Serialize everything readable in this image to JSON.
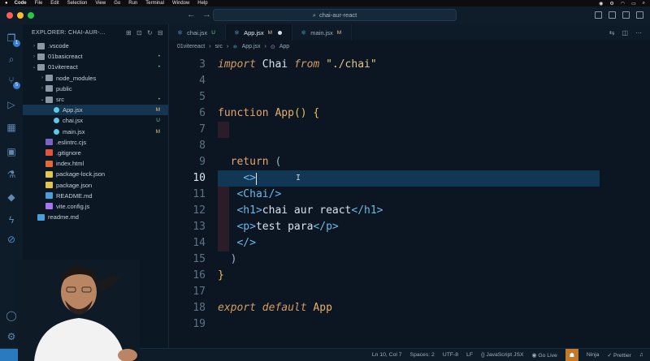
{
  "menubar": {
    "items": [
      "Code",
      "File",
      "Edit",
      "Selection",
      "View",
      "Go",
      "Run",
      "Terminal",
      "Window",
      "Help"
    ]
  },
  "titlebar": {
    "search": "chai-aur-react"
  },
  "activity": {
    "explorer_badge": "1",
    "scm_badge": "5"
  },
  "sidebar": {
    "title": "EXPLORER: CHAI-AUR-...",
    "tree": [
      {
        "name": ".vscode",
        "type": "folder",
        "depth": 0,
        "open": false,
        "status": ""
      },
      {
        "name": "01basicreact",
        "type": "folder",
        "depth": 0,
        "open": false,
        "status": "•"
      },
      {
        "name": "01vitereact",
        "type": "folder",
        "depth": 0,
        "open": true,
        "status": "•"
      },
      {
        "name": "node_modules",
        "type": "folder",
        "depth": 1,
        "open": false,
        "status": ""
      },
      {
        "name": "public",
        "type": "folder",
        "depth": 1,
        "open": false,
        "status": ""
      },
      {
        "name": "src",
        "type": "folder",
        "depth": 1,
        "open": true,
        "status": "•"
      },
      {
        "name": "App.jsx",
        "type": "react",
        "depth": 2,
        "status": "M",
        "selected": true
      },
      {
        "name": "chai.jsx",
        "type": "react",
        "depth": 2,
        "status": "U"
      },
      {
        "name": "main.jsx",
        "type": "react",
        "depth": 2,
        "status": "M"
      },
      {
        "name": ".eslintrc.cjs",
        "type": "eslint",
        "depth": 1,
        "status": ""
      },
      {
        "name": ".gitignore",
        "type": "git",
        "depth": 1,
        "status": ""
      },
      {
        "name": "index.html",
        "type": "html",
        "depth": 1,
        "status": ""
      },
      {
        "name": "package-lock.json",
        "type": "json",
        "depth": 1,
        "status": ""
      },
      {
        "name": "package.json",
        "type": "json",
        "depth": 1,
        "status": ""
      },
      {
        "name": "README.md",
        "type": "md",
        "depth": 1,
        "status": ""
      },
      {
        "name": "vite.config.js",
        "type": "vite",
        "depth": 1,
        "status": ""
      },
      {
        "name": "readme.md",
        "type": "md",
        "depth": 0,
        "status": ""
      }
    ]
  },
  "tabs": [
    {
      "label": "chai.jsx",
      "mark": "U",
      "active": false
    },
    {
      "label": "App.jsx",
      "mark": "M",
      "active": true,
      "dirty": true
    },
    {
      "label": "main.jsx",
      "mark": "M",
      "active": false
    }
  ],
  "breadcrumb": [
    "01vitereact",
    "src",
    "App.jsx",
    "App"
  ],
  "code": {
    "line_numbers": [
      "3",
      "4",
      "5",
      "6",
      "7",
      "8",
      "9",
      "10",
      "11",
      "12",
      "13",
      "14",
      "15",
      "16",
      "17",
      "18",
      "19"
    ],
    "current_line": "10"
  },
  "statusbar": {
    "position": "Ln 10, Col 7",
    "spaces": "Spaces: 2",
    "encoding": "UTF-8",
    "eol": "LF",
    "language": "JavaScript JSX",
    "go_live": "Go Live",
    "ninja": "Ninja",
    "prettier": "Prettier"
  },
  "colors": {
    "modified": "#e2c08d",
    "untracked": "#73c991",
    "accent": "#2a7ac0"
  }
}
